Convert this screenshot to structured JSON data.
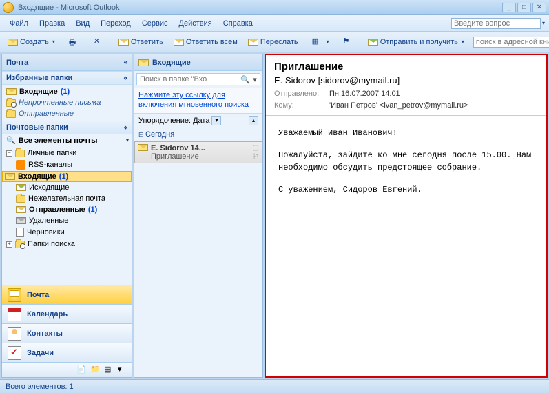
{
  "title": "Входящие - Microsoft Outlook",
  "menu": {
    "file": "Файл",
    "edit": "Правка",
    "view": "Вид",
    "go": "Переход",
    "tools": "Сервис",
    "actions": "Действия",
    "help": "Справка",
    "ask_placeholder": "Введите вопрос"
  },
  "toolbar": {
    "new": "Создать",
    "reply": "Ответить",
    "reply_all": "Ответить всем",
    "forward": "Переслать",
    "send_receive": "Отправить и получить",
    "addr_search_placeholder": "поиск в адресной книге"
  },
  "nav": {
    "header": "Почта",
    "fav_header": "Избранные папки",
    "favs": [
      {
        "label": "Входящие",
        "count": "(1)",
        "bold": true
      },
      {
        "label": "Непрочтенные письма",
        "italic": true
      },
      {
        "label": "Отправленные",
        "italic": true
      }
    ],
    "mail_header": "Почтовые папки",
    "all_items": "Все элементы почты",
    "tree": {
      "root": "Личные папки",
      "items": [
        {
          "label": "RSS-каналы"
        },
        {
          "label": "Входящие",
          "count": "(1)",
          "bold": true,
          "sel": true
        },
        {
          "label": "Исходящие"
        },
        {
          "label": "Нежелательная почта"
        },
        {
          "label": "Отправленные",
          "count": "(1)"
        },
        {
          "label": "Удаленные"
        },
        {
          "label": "Черновики"
        }
      ],
      "search_folders": "Папки поиска"
    },
    "buttons": {
      "mail": "Почта",
      "calendar": "Календарь",
      "contacts": "Контакты",
      "tasks": "Задачи"
    }
  },
  "list": {
    "header": "Входящие",
    "search_placeholder": "Поиск в папке \"Вхо",
    "instant_hint": "Нажмите эту ссылку для включения мгновенного поиска",
    "arrange": "Упорядочение: Дата",
    "today": "Сегодня",
    "msg": {
      "from": "E. Sidorov 14...",
      "subject": "Приглашение"
    }
  },
  "reading": {
    "subject": "Приглашение",
    "from": "E. Sidorov [sidorov@mymail.ru]",
    "sent_label": "Отправлено:",
    "sent_value": "Пн 16.07.2007 14:01",
    "to_label": "Кому:",
    "to_value": "'Иван Петров' <ivan_petrov@mymail.ru>",
    "body": {
      "p1": "Уважаемый Иван Иванович!",
      "p2": "Пожалуйста, зайдите ко мне сегодня после 15.00. Нам необходимо обсудить предстоящее собрание.",
      "p3": "С уважением, Сидоров Евгений."
    }
  },
  "status": "Всего элементов: 1"
}
